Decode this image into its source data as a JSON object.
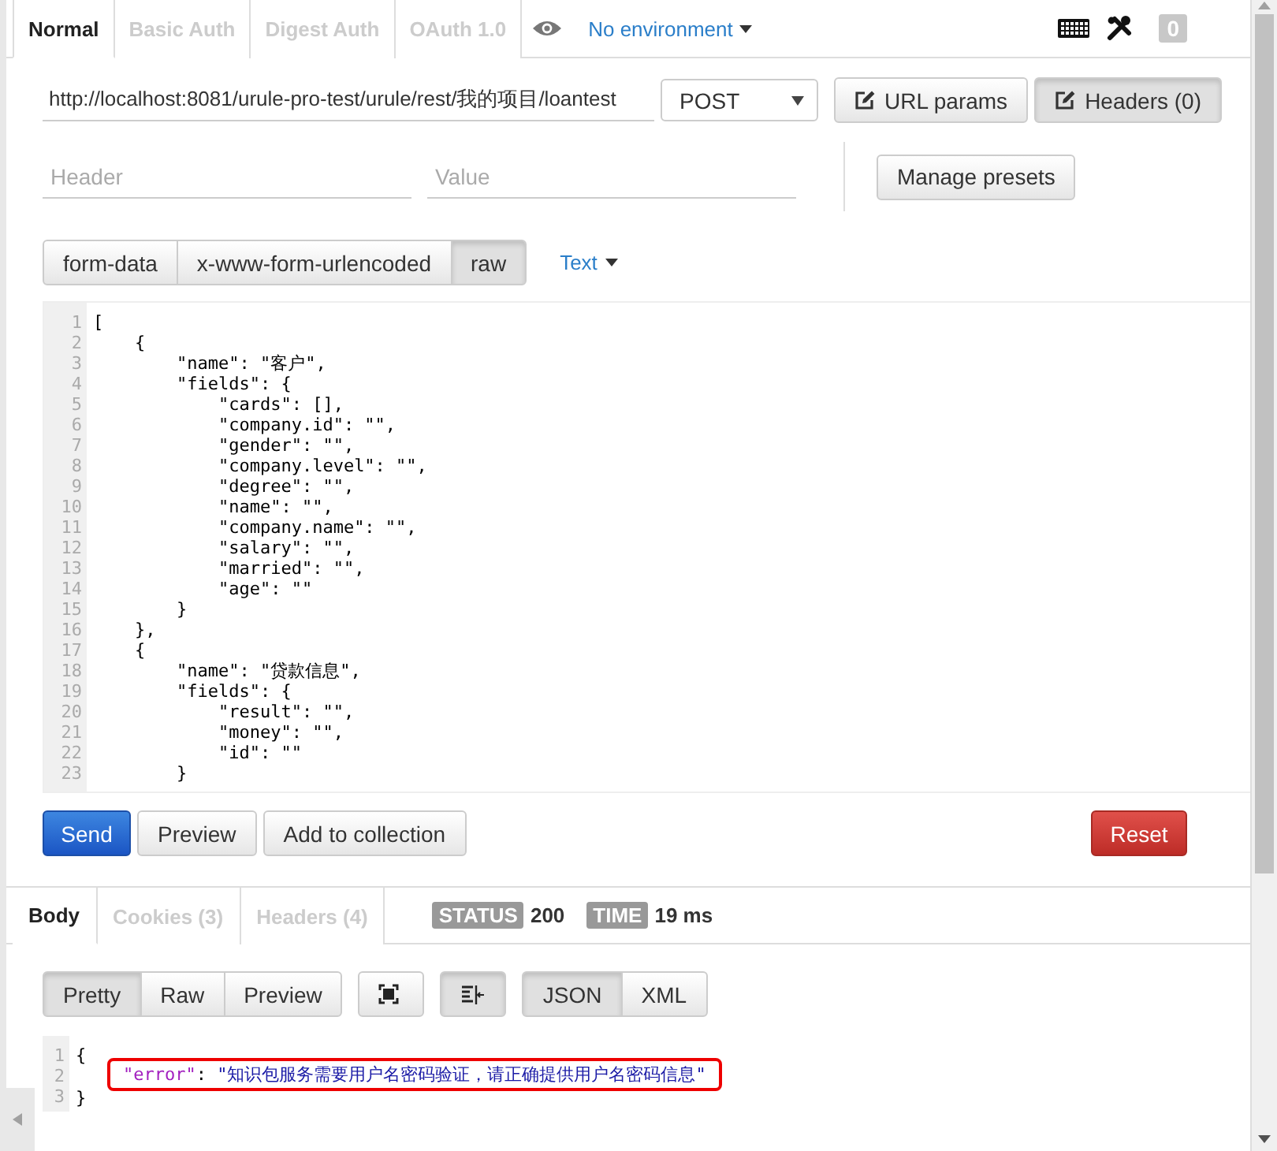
{
  "request_tabs": [
    {
      "label": "Normal",
      "selected": true
    },
    {
      "label": "Basic Auth",
      "selected": false
    },
    {
      "label": "Digest Auth",
      "selected": false
    },
    {
      "label": "OAuth 1.0",
      "selected": false
    }
  ],
  "environment": {
    "label": "No environment"
  },
  "counter": "0",
  "url": {
    "value": "http://localhost:8081/urule-pro-test/urule/rest/我的项目/loantest"
  },
  "method": {
    "value": "POST"
  },
  "url_buttons": [
    {
      "label": "URL params",
      "selected": false
    },
    {
      "label": "Headers (0)",
      "selected": true
    }
  ],
  "header_fields": [
    {
      "placeholder": "Header"
    },
    {
      "placeholder": "Value"
    }
  ],
  "manage_presets": "Manage presets",
  "body_modes": [
    {
      "label": "form-data",
      "selected": false
    },
    {
      "label": "x-www-form-urlencoded",
      "selected": false
    },
    {
      "label": "raw",
      "selected": true
    }
  ],
  "content_type": "Text",
  "editor_lines": [
    {
      "number": "1",
      "text": "["
    },
    {
      "number": "2",
      "text": "    {"
    },
    {
      "number": "3",
      "text": "        \"name\": \"客户\","
    },
    {
      "number": "4",
      "text": "        \"fields\": {"
    },
    {
      "number": "5",
      "text": "            \"cards\": [],"
    },
    {
      "number": "6",
      "text": "            \"company.id\": \"\","
    },
    {
      "number": "7",
      "text": "            \"gender\": \"\","
    },
    {
      "number": "8",
      "text": "            \"company.level\": \"\","
    },
    {
      "number": "9",
      "text": "            \"degree\": \"\","
    },
    {
      "number": "10",
      "text": "            \"name\": \"\","
    },
    {
      "number": "11",
      "text": "            \"company.name\": \"\","
    },
    {
      "number": "12",
      "text": "            \"salary\": \"\","
    },
    {
      "number": "13",
      "text": "            \"married\": \"\","
    },
    {
      "number": "14",
      "text": "            \"age\": \"\""
    },
    {
      "number": "15",
      "text": "        }"
    },
    {
      "number": "16",
      "text": "    },"
    },
    {
      "number": "17",
      "text": "    {"
    },
    {
      "number": "18",
      "text": "        \"name\": \"贷款信息\","
    },
    {
      "number": "19",
      "text": "        \"fields\": {"
    },
    {
      "number": "20",
      "text": "            \"result\": \"\","
    },
    {
      "number": "21",
      "text": "            \"money\": \"\","
    },
    {
      "number": "22",
      "text": "            \"id\": \"\""
    },
    {
      "number": "23",
      "text": "        }"
    }
  ],
  "actions": [
    {
      "label": "Send",
      "kind": "primary"
    },
    {
      "label": "Preview",
      "kind": "default"
    },
    {
      "label": "Add to collection",
      "kind": "default"
    },
    {
      "label": "Reset",
      "kind": "danger"
    }
  ],
  "response_tabs": [
    {
      "label": "Body",
      "selected": true
    },
    {
      "label": "Cookies (3)",
      "selected": false
    },
    {
      "label": "Headers (4)",
      "selected": false
    }
  ],
  "status": {
    "label": "STATUS",
    "value": "200"
  },
  "time": {
    "label": "TIME",
    "value": "19 ms"
  },
  "view_modes": [
    {
      "label": "Pretty",
      "selected": true
    },
    {
      "label": "Raw",
      "selected": false
    },
    {
      "label": "Preview",
      "selected": false
    }
  ],
  "icon_buttons": [
    {
      "kind": "fullscreen",
      "selected": false
    },
    {
      "kind": "wrap",
      "selected": true
    }
  ],
  "format_modes": [
    {
      "label": "JSON",
      "selected": true
    },
    {
      "label": "XML",
      "selected": false
    }
  ],
  "response_lines": [
    {
      "number": "1",
      "text": "{",
      "highlighted": false
    },
    {
      "number": "2",
      "key": "\"error\"",
      "colon": ":",
      "value": "\"知识包服务需要用户名密码验证，请正确提供用户名密码信息\"",
      "highlighted": true
    },
    {
      "number": "3",
      "text": "}",
      "highlighted": false
    }
  ]
}
